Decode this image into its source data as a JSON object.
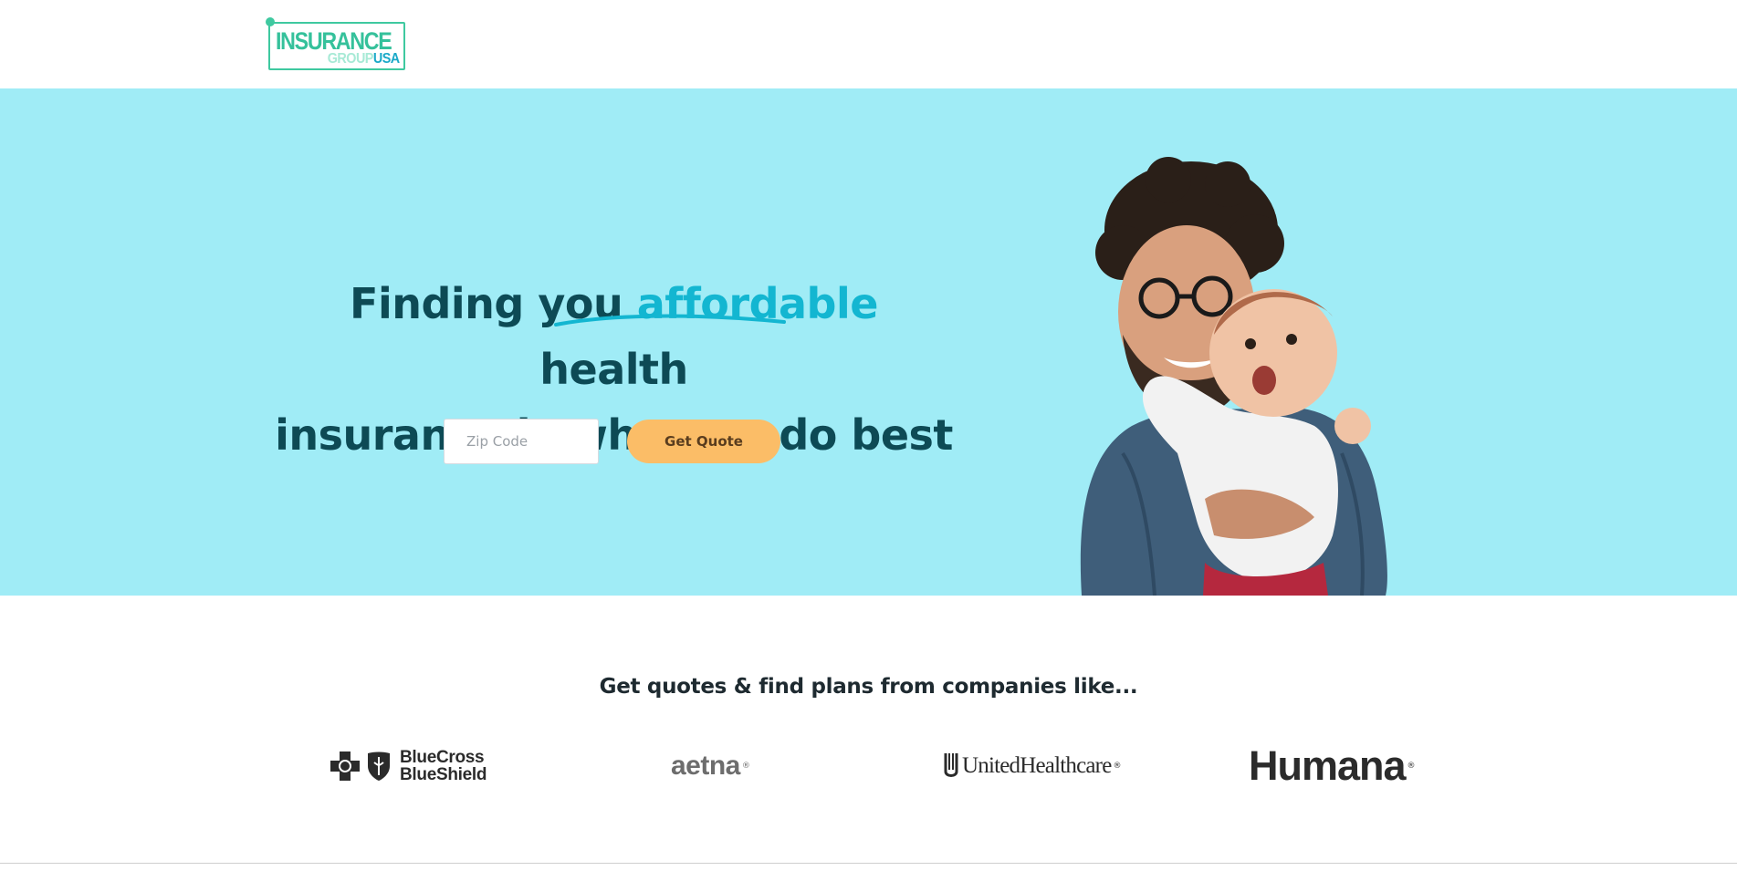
{
  "header": {
    "logo": {
      "word1": "INSURANCE",
      "word2_a": "GROUP",
      "word2_b": "USA"
    }
  },
  "hero": {
    "headline": {
      "part1": "Finding you ",
      "highlight": "affordable",
      "part2": " health",
      "line2": "insurance is what we do best"
    },
    "zip_placeholder": "Zip Code",
    "zip_value": "",
    "cta_label": "Get Quote",
    "colors": {
      "background": "#a0ecf6",
      "headline": "#0d4a55",
      "highlight": "#13b6d1",
      "cta": "#fbbd67"
    }
  },
  "companies": {
    "title": "Get quotes & find plans from companies like...",
    "logos": [
      {
        "name": "bluecross-blueshield",
        "line1": "BlueCross",
        "line2": "BlueShield"
      },
      {
        "name": "aetna",
        "text": "aetna"
      },
      {
        "name": "unitedhealthcare",
        "text": "UnitedHealthcare"
      },
      {
        "name": "humana",
        "text": "Humana"
      }
    ]
  }
}
